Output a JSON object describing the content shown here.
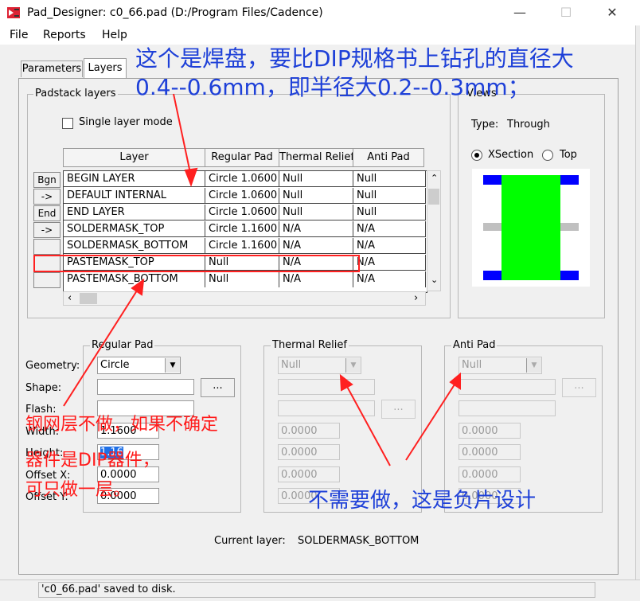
{
  "window": {
    "title": "Pad_Designer: c0_66.pad (D:/Program Files/Cadence)",
    "min": "—",
    "max": "☐",
    "close": "✕"
  },
  "menu": {
    "file": "File",
    "reports": "Reports",
    "help": "Help"
  },
  "tabs": {
    "parameters": "Parameters",
    "layers": "Layers"
  },
  "padstack": {
    "group_label": "Padstack layers",
    "single_layer_mode": "Single layer mode",
    "headers": {
      "layer": "Layer",
      "regular": "Regular Pad",
      "thermal": "Thermal Relief",
      "anti": "Anti Pad"
    },
    "buttons": [
      "Bgn",
      "->",
      "End",
      "->",
      "",
      "",
      ""
    ],
    "rows": [
      {
        "layer": "BEGIN LAYER",
        "regular": "Circle 1.0600",
        "thermal": "Null",
        "anti": "Null"
      },
      {
        "layer": "DEFAULT INTERNAL",
        "regular": "Circle 1.0600",
        "thermal": "Null",
        "anti": "Null"
      },
      {
        "layer": "END LAYER",
        "regular": "Circle 1.0600",
        "thermal": "Null",
        "anti": "Null"
      },
      {
        "layer": "SOLDERMASK_TOP",
        "regular": "Circle 1.1600",
        "thermal": "N/A",
        "anti": "N/A"
      },
      {
        "layer": "SOLDERMASK_BOTTOM",
        "regular": "Circle 1.1600",
        "thermal": "N/A",
        "anti": "N/A"
      },
      {
        "layer": "PASTEMASK_TOP",
        "regular": "Null",
        "thermal": "N/A",
        "anti": "N/A"
      },
      {
        "layer": "PASTEMASK_BOTTOM",
        "regular": "Null",
        "thermal": "N/A",
        "anti": "N/A"
      }
    ]
  },
  "views": {
    "group_label": "Views",
    "type_label": "Type:",
    "type_value": "Through",
    "xsection": "XSection",
    "top": "Top",
    "colors": {
      "pad": "#00ff00",
      "edge": "#0000ff",
      "internal": "#c0c0c0"
    }
  },
  "regular_pad": {
    "group_label": "Regular Pad",
    "geometry_label": "Geometry:",
    "geometry_value": "Circle",
    "shape_label": "Shape:",
    "flash_label": "Flash:",
    "width_label": "Width:",
    "width_value": "1.1600",
    "height_label": "Height:",
    "height_value": "1.16",
    "offx_label": "Offset X:",
    "offx_value": "0.0000",
    "offy_label": "Offset Y:",
    "offy_value": "0.0000",
    "browse": "..."
  },
  "thermal": {
    "group_label": "Thermal Relief",
    "geometry_value": "Null",
    "values": [
      "0.0000",
      "0.0000",
      "0.0000",
      "0.0000"
    ],
    "browse": "..."
  },
  "anti": {
    "group_label": "Anti Pad",
    "geometry_value": "Null",
    "values": [
      "0.0000",
      "0.0000",
      "0.0000",
      "0.0000"
    ],
    "browse": "..."
  },
  "current_layer": {
    "label": "Current layer:",
    "value": "SOLDERMASK_BOTTOM"
  },
  "status": {
    "text": "'c0_66.pad' saved to disk."
  },
  "annotations": {
    "top_line1": "这个是焊盘，要比DIP规格书上钻孔的直径大",
    "top_line2": "0.4--0.6mm，即半径大0.2--0.3mm；",
    "left_line1": "钢网层不做，如果不确定",
    "left_line2": "器件是DIP器件，",
    "left_line3": "可只做一层。",
    "right": "不需要做，这是负片设计",
    "color_blue": "#1e40d8",
    "color_red": "#ff1a1a"
  }
}
